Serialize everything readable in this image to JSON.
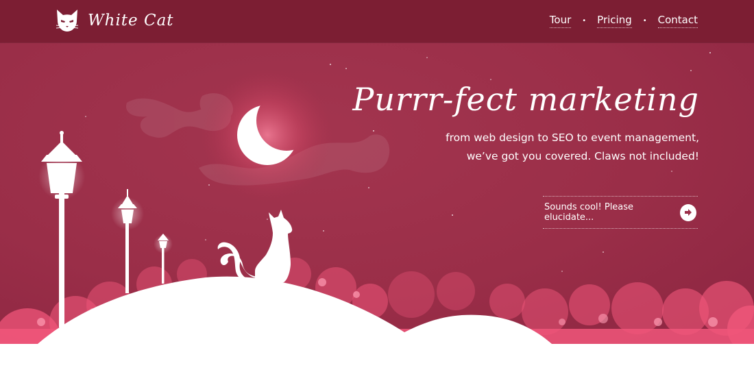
{
  "brand": {
    "name": "White Cat",
    "icon": "cat-head-icon"
  },
  "nav": {
    "items": [
      {
        "label": "Tour"
      },
      {
        "label": "Pricing"
      },
      {
        "label": "Contact"
      }
    ],
    "separator": "•"
  },
  "hero": {
    "headline": "Purrr-fect marketing",
    "subtitle_line1": "from web design to SEO to event management,",
    "subtitle_line2": "we’ve got you covered. Claws not included!",
    "cta_label": "Sounds cool! Please elucidate...",
    "cta_icon": "arrow-right-icon"
  },
  "colors": {
    "hero_bg": "#9a2e48",
    "topbar_bg": "#7c1e33",
    "cloud_pink": "#f0567a",
    "text": "#ffffff"
  }
}
